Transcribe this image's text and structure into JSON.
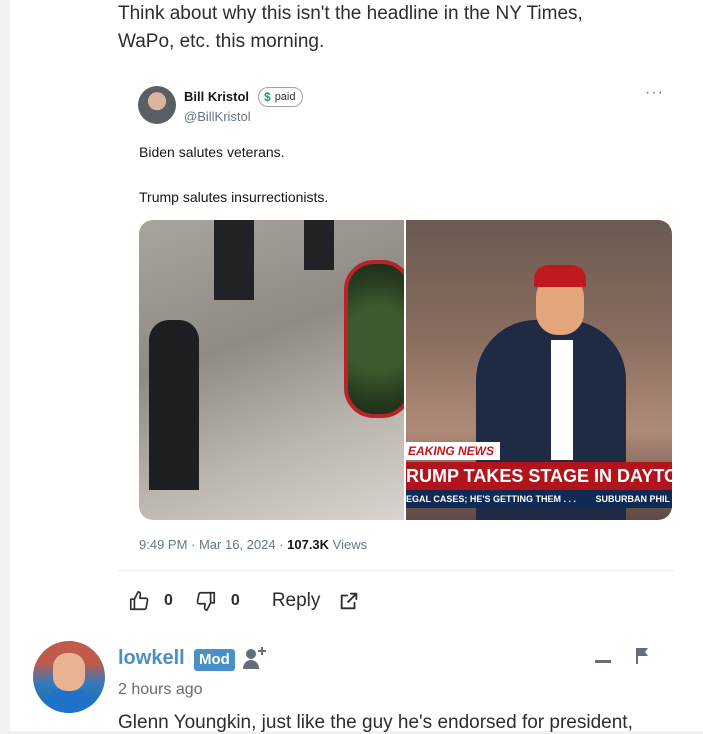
{
  "comment": {
    "text_line1": "Think about why this isn't the headline in the NY Times,",
    "text_line2": "WaPo, etc. this morning."
  },
  "tweet": {
    "author_name": "Bill Kristol",
    "badge_symbol": "$",
    "badge_label": "paid",
    "handle": "@BillKristol",
    "more_label": "···",
    "line1": "Biden salutes veterans.",
    "line2": "Trump salutes insurrectionists.",
    "image_breaking": "EAKING NEWS",
    "image_headline": "RUMP TAKES STAGE IN DAYTON",
    "image_ticker_left": "EGAL CASES; HE'S GETTING THEM . . .",
    "image_ticker_right": "SUBURBAN PHIL",
    "time_date": "9:49 PM · Mar 16, 2024 · ",
    "views_count": "107.3K",
    "views_label": " Views"
  },
  "actions": {
    "upvote_count": "0",
    "downvote_count": "0",
    "reply_label": "Reply"
  },
  "reply_comment": {
    "username": "lowkell",
    "badge": "Mod",
    "timestamp": "2 hours ago",
    "text": "Glenn Youngkin, just like the guy he's endorsed for president,"
  },
  "colors": {
    "username": "#4a90c8",
    "mod_badge": "#4a90c8",
    "text": "#2a2e2e"
  }
}
